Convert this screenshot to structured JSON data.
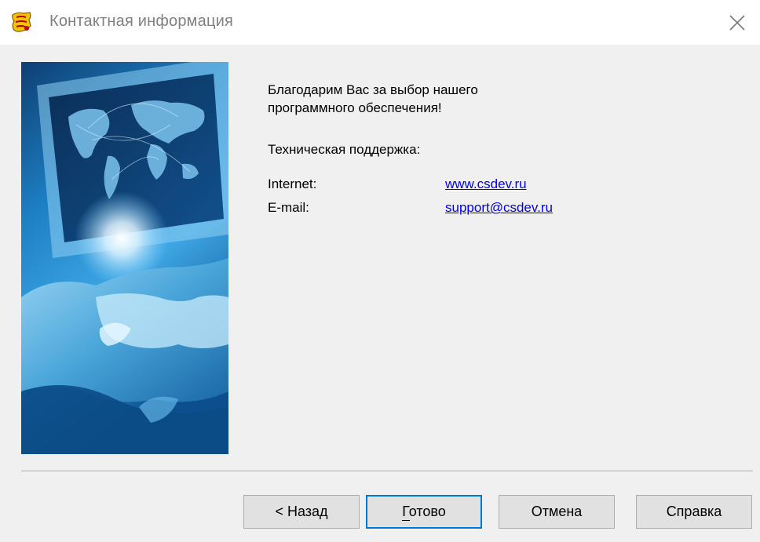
{
  "window": {
    "title": "Контактная информация",
    "app_icon": "setup-app-icon",
    "close_icon": "close-icon"
  },
  "content": {
    "thanks_text": "Благодарим Вас за выбор нашего программного обеспечения!",
    "support_heading": "Техническая поддержка:",
    "contacts": [
      {
        "label": "Internet:",
        "value": "www.csdev.ru"
      },
      {
        "label": "E-mail:",
        "value": "support@csdev.ru"
      }
    ]
  },
  "buttons": {
    "back": "< Назад",
    "finish": "Готово",
    "cancel": "Отмена",
    "help": "Справка"
  },
  "colors": {
    "link": "#0000ee",
    "default_button_border": "#0078d7",
    "dialog_background": "#f0f0f0"
  }
}
